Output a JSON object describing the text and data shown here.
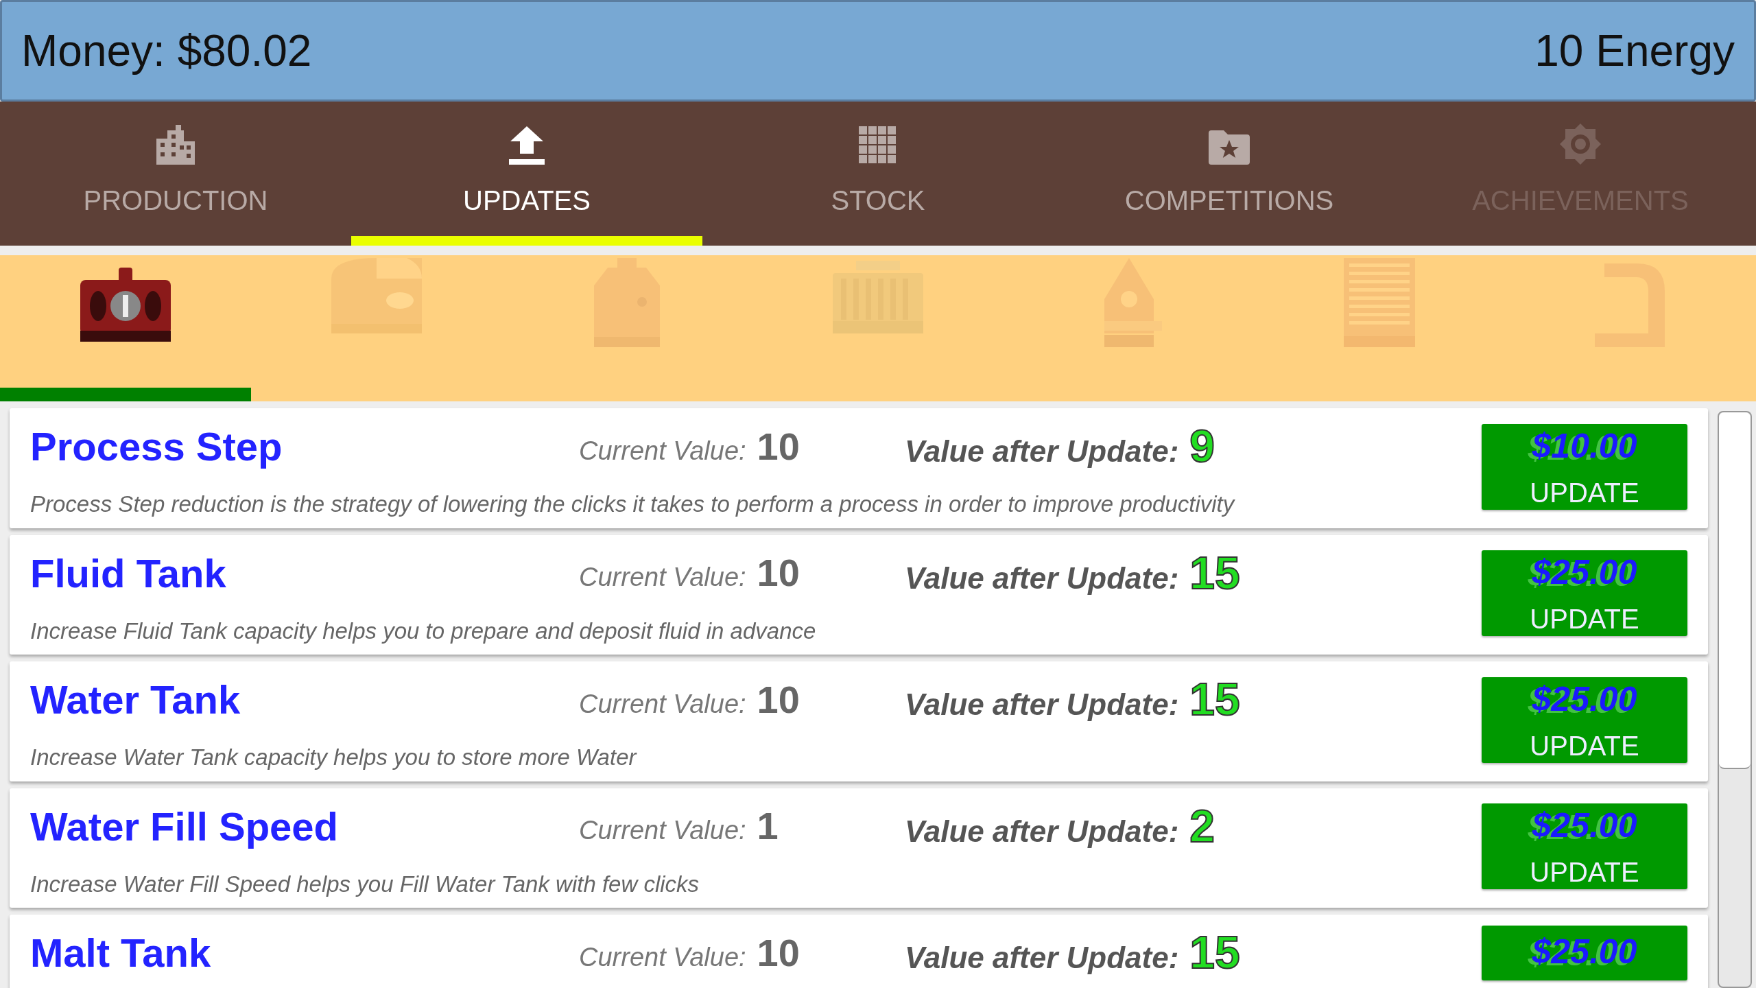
{
  "header": {
    "money": "Money: $80.02",
    "energy": "10 Energy"
  },
  "tabs": [
    {
      "label": "PRODUCTION",
      "selected": false,
      "disabled": false
    },
    {
      "label": "UPDATES",
      "selected": true,
      "disabled": false
    },
    {
      "label": "STOCK",
      "selected": false,
      "disabled": false
    },
    {
      "label": "COMPETITIONS",
      "selected": false,
      "disabled": false
    },
    {
      "label": "ACHIEVEMENTS",
      "selected": false,
      "disabled": true
    }
  ],
  "machine_tabs": [
    {
      "selected": true
    },
    {
      "selected": false
    },
    {
      "selected": false
    },
    {
      "selected": false
    },
    {
      "selected": false
    },
    {
      "selected": false
    },
    {
      "selected": false
    }
  ],
  "updates": [
    {
      "title": "Process Step",
      "current_label": "Current Value:",
      "current": "10",
      "after_label": "Value after Update:",
      "after": "9",
      "price": "$10.00",
      "button": "UPDATE",
      "description": "Process Step reduction is the strategy of lowering the clicks it takes to perform a process in order to improve productivity"
    },
    {
      "title": "Fluid Tank",
      "current_label": "Current Value:",
      "current": "10",
      "after_label": "Value after Update:",
      "after": "15",
      "price": "$25.00",
      "button": "UPDATE",
      "description": "Increase Fluid Tank capacity helps you to prepare and deposit fluid in advance"
    },
    {
      "title": "Water Tank",
      "current_label": "Current Value:",
      "current": "10",
      "after_label": "Value after Update:",
      "after": "15",
      "price": "$25.00",
      "button": "UPDATE",
      "description": "Increase Water Tank capacity helps you to store more Water"
    },
    {
      "title": "Water Fill Speed",
      "current_label": "Current Value:",
      "current": "1",
      "after_label": "Value after Update:",
      "after": "2",
      "price": "$25.00",
      "button": "UPDATE",
      "description": "Increase Water Fill Speed helps you Fill Water Tank with few clicks"
    },
    {
      "title": "Malt Tank",
      "current_label": "Current Value:",
      "current": "10",
      "after_label": "Value after Update:",
      "after": "15",
      "price": "$25.00"
    }
  ]
}
